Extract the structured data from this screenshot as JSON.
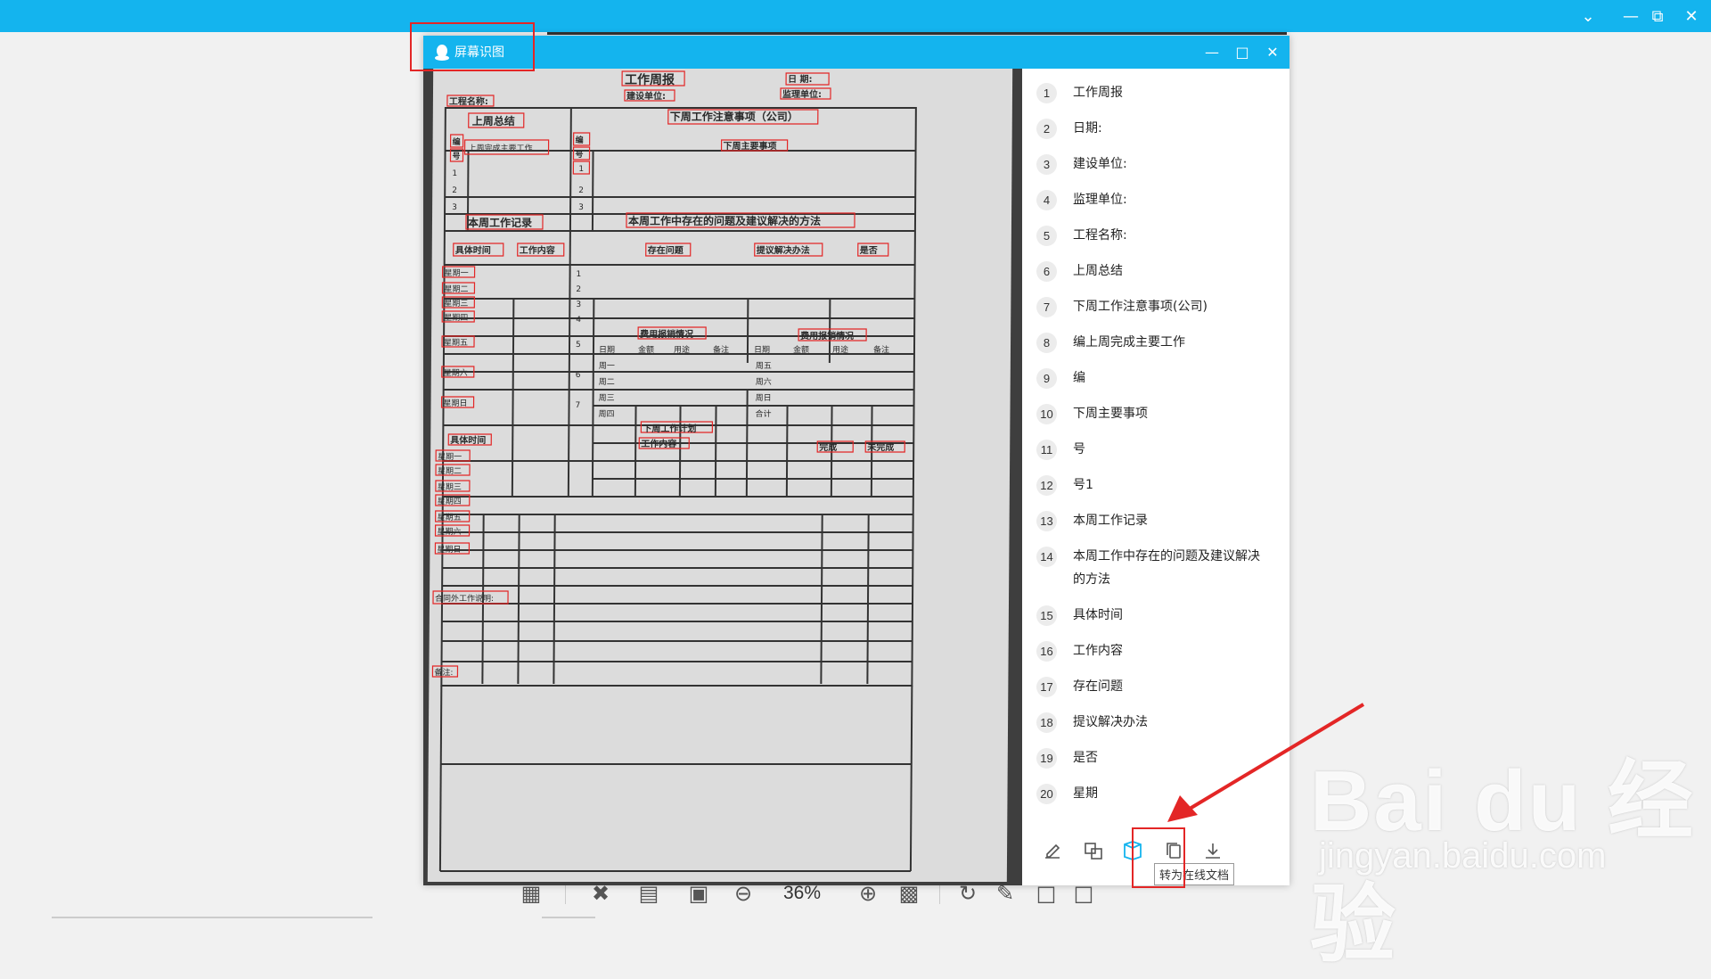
{
  "dialog": {
    "title": "屏幕识图",
    "tooltip": "转为在线文档"
  },
  "toolbar": {
    "zoom": "36%"
  },
  "text_list": [
    {
      "num": "1",
      "text": "工作周报"
    },
    {
      "num": "2",
      "text": "日期:"
    },
    {
      "num": "3",
      "text": "建设单位:"
    },
    {
      "num": "4",
      "text": "监理单位:"
    },
    {
      "num": "5",
      "text": "工程名称:"
    },
    {
      "num": "6",
      "text": "上周总结"
    },
    {
      "num": "7",
      "text": "下周工作注意事项(公司)"
    },
    {
      "num": "8",
      "text": "编上周完成主要工作"
    },
    {
      "num": "9",
      "text": "编"
    },
    {
      "num": "10",
      "text": "下周主要事项"
    },
    {
      "num": "11",
      "text": "号"
    },
    {
      "num": "12",
      "text": "号1"
    },
    {
      "num": "13",
      "text": "本周工作记录"
    },
    {
      "num": "14",
      "text": "本周工作中存在的问题及建议解决的方法"
    },
    {
      "num": "15",
      "text": "具体时间"
    },
    {
      "num": "16",
      "text": "工作内容"
    },
    {
      "num": "17",
      "text": "存在问题"
    },
    {
      "num": "18",
      "text": "提议解决办法"
    },
    {
      "num": "19",
      "text": "是否"
    },
    {
      "num": "20",
      "text": "星期"
    }
  ],
  "document": {
    "title": "工作周报",
    "date_label": "日  期:",
    "construction_unit": "建设单位:",
    "supervision_unit": "监理单位:",
    "project_name": "工程名称:",
    "last_week_summary": "上周总结",
    "next_week_notes": "下周工作注意事项（公司）",
    "col_no_1": "编",
    "col_no_2": "号",
    "last_week_done": "上周完成主要工作",
    "next_week_main": "下周主要事项",
    "week_record": "本周工作记录",
    "problems_methods": "本周工作中存在的问题及建议解决的方法",
    "specific_time": "具体时间",
    "work_content": "工作内容",
    "problem": "存在问题",
    "proposal": "提议解决办法",
    "yes_no": "是否",
    "expense": "费用报销情况",
    "exp_cols": [
      "日期",
      "金额",
      "用途",
      "备注"
    ],
    "days_left": [
      "周一",
      "周二",
      "周三",
      "周四"
    ],
    "days_right": [
      "周五",
      "周六",
      "周日",
      "合计"
    ],
    "weekdays": [
      "星期一",
      "星期二",
      "星期三",
      "星期四",
      "星期五",
      "星期六",
      "星期日"
    ],
    "row_nums": [
      "1",
      "2",
      "3"
    ],
    "row_nums2": [
      "1",
      "2",
      "3",
      "4",
      "5",
      "6",
      "7"
    ],
    "next_week_plan": "下周工作计划",
    "done": "完成",
    "not_done": "未完成",
    "contract_extra": "合同外工作说明:",
    "remarks": "备注:"
  },
  "watermark": {
    "logo": "Bai du 经验",
    "url": "jingyan.baidu.com"
  },
  "colors": {
    "accent": "#14b4ee",
    "highlight": "#e32626",
    "active_icon": "#14b4ee"
  }
}
